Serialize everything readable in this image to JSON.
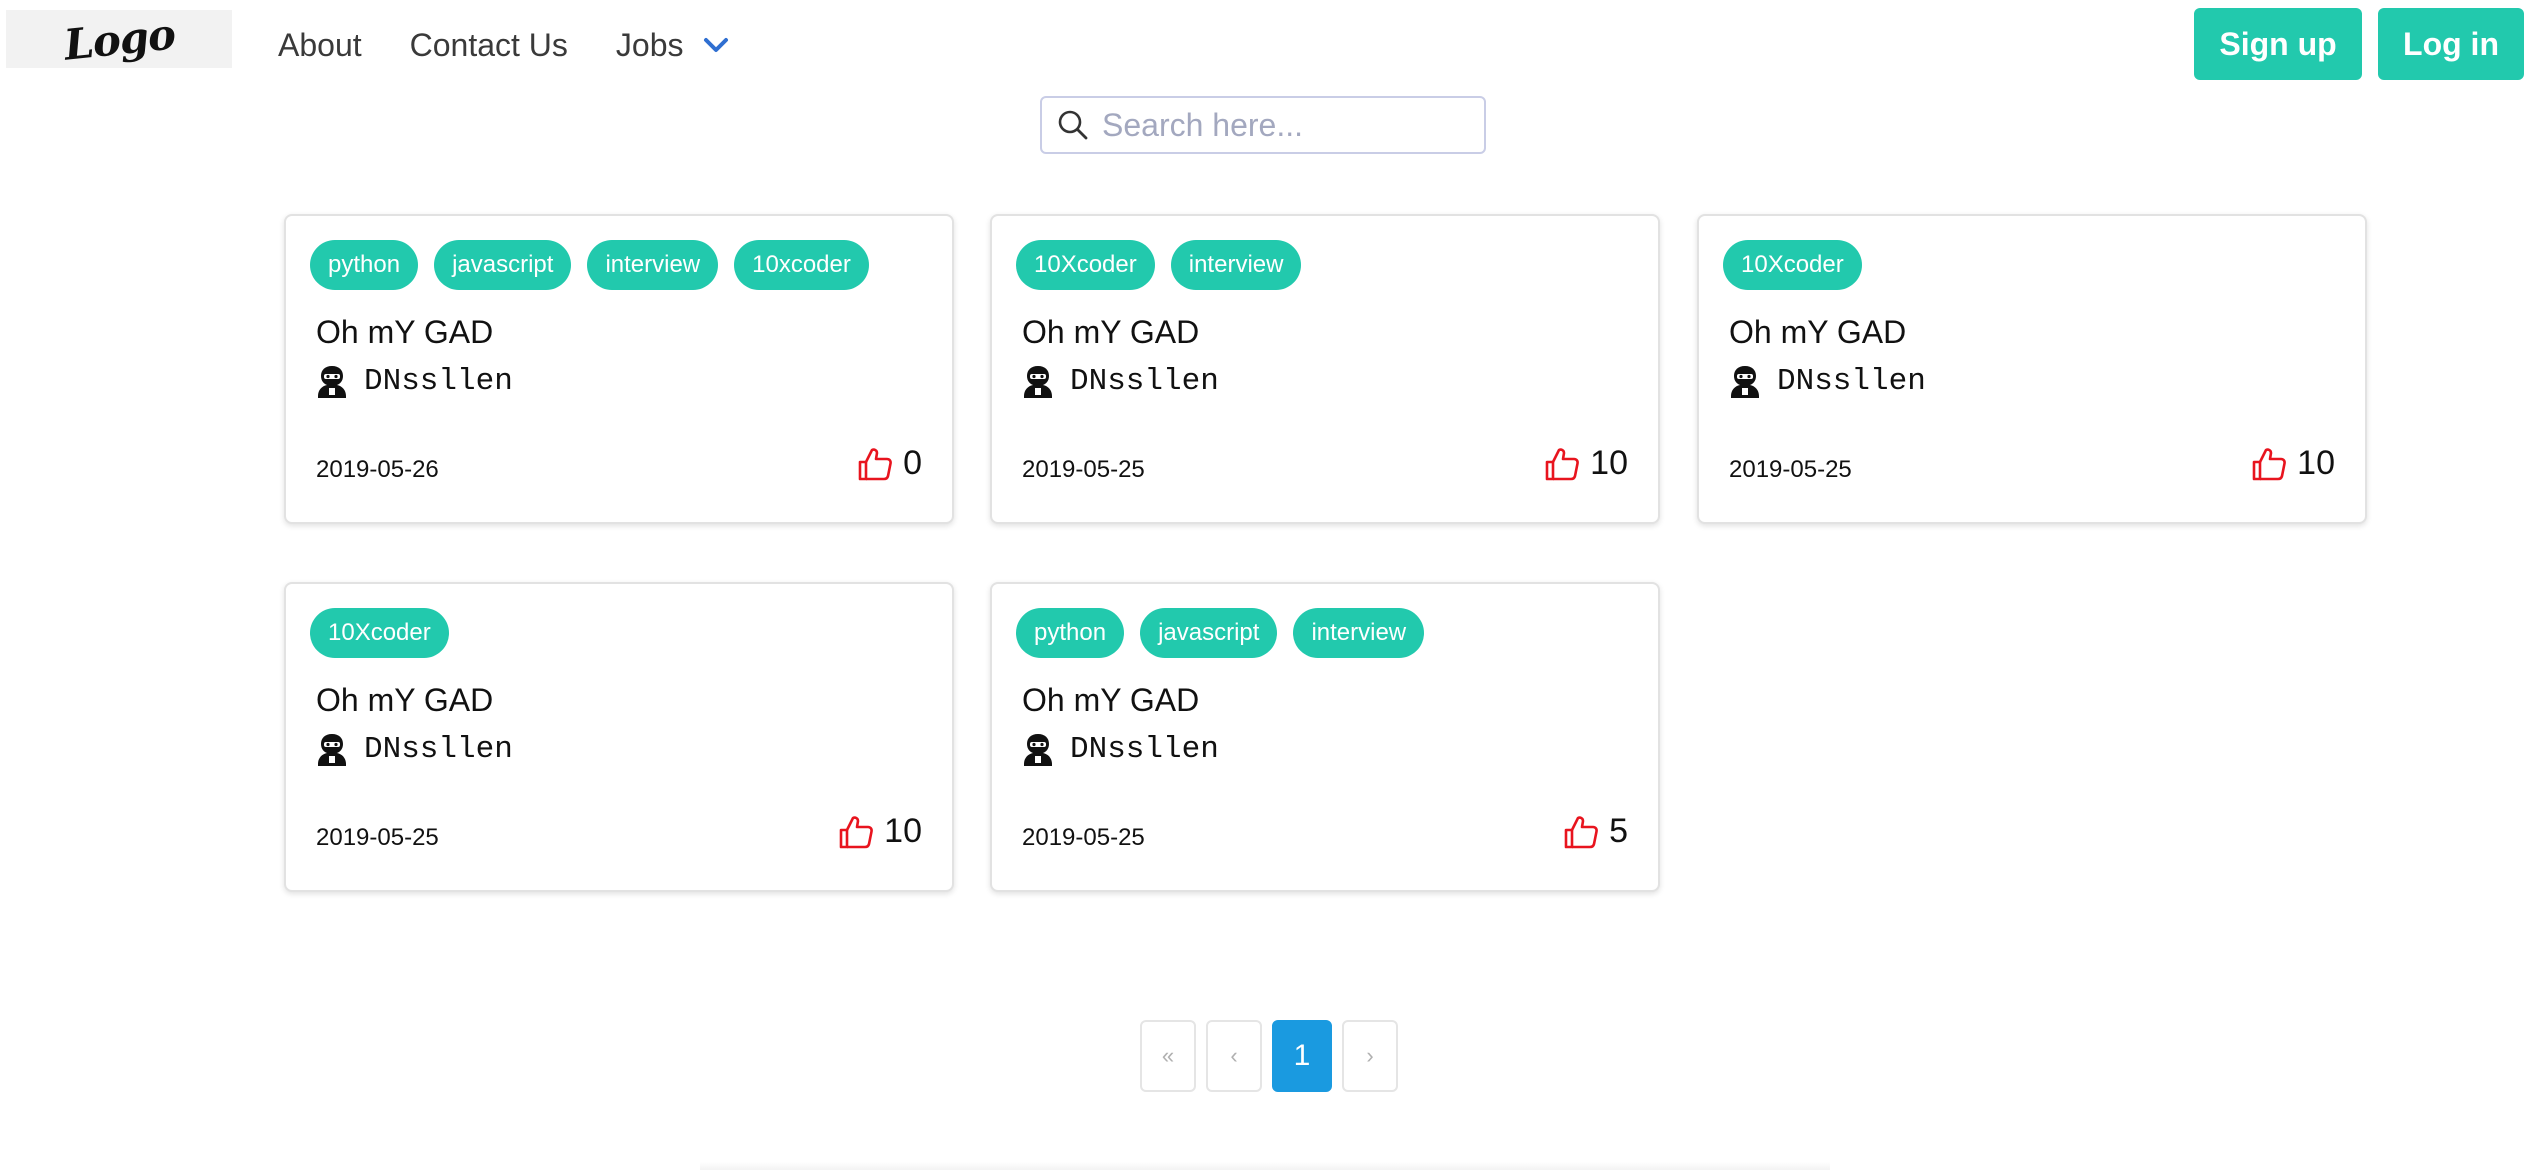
{
  "brand": {
    "logo_text": "Logo"
  },
  "nav": {
    "links": [
      "About",
      "Contact Us"
    ],
    "jobs_label": "Jobs"
  },
  "auth": {
    "signup_label": "Sign up",
    "login_label": "Log in"
  },
  "search": {
    "placeholder": "Search here..."
  },
  "colors": {
    "accent": "#22c9ad",
    "like_icon": "#e8141e",
    "page_active": "#1a9ae0"
  },
  "cards": [
    {
      "tags": [
        "python",
        "javascript",
        "interview",
        "10xcoder"
      ],
      "title": "Oh mY GAD",
      "author": "DNssllen",
      "date": "2019-05-26",
      "likes": "0"
    },
    {
      "tags": [
        "10Xcoder",
        "interview"
      ],
      "title": "Oh mY GAD",
      "author": "DNssllen",
      "date": "2019-05-25",
      "likes": "10"
    },
    {
      "tags": [
        "10Xcoder"
      ],
      "title": "Oh mY GAD",
      "author": "DNssllen",
      "date": "2019-05-25",
      "likes": "10"
    },
    {
      "tags": [
        "10Xcoder"
      ],
      "title": "Oh mY GAD",
      "author": "DNssllen",
      "date": "2019-05-25",
      "likes": "10"
    },
    {
      "tags": [
        "python",
        "javascript",
        "interview"
      ],
      "title": "Oh mY GAD",
      "author": "DNssllen",
      "date": "2019-05-25",
      "likes": "5"
    }
  ],
  "pagination": {
    "first": "«",
    "prev": "‹",
    "current": "1",
    "next": "›"
  }
}
